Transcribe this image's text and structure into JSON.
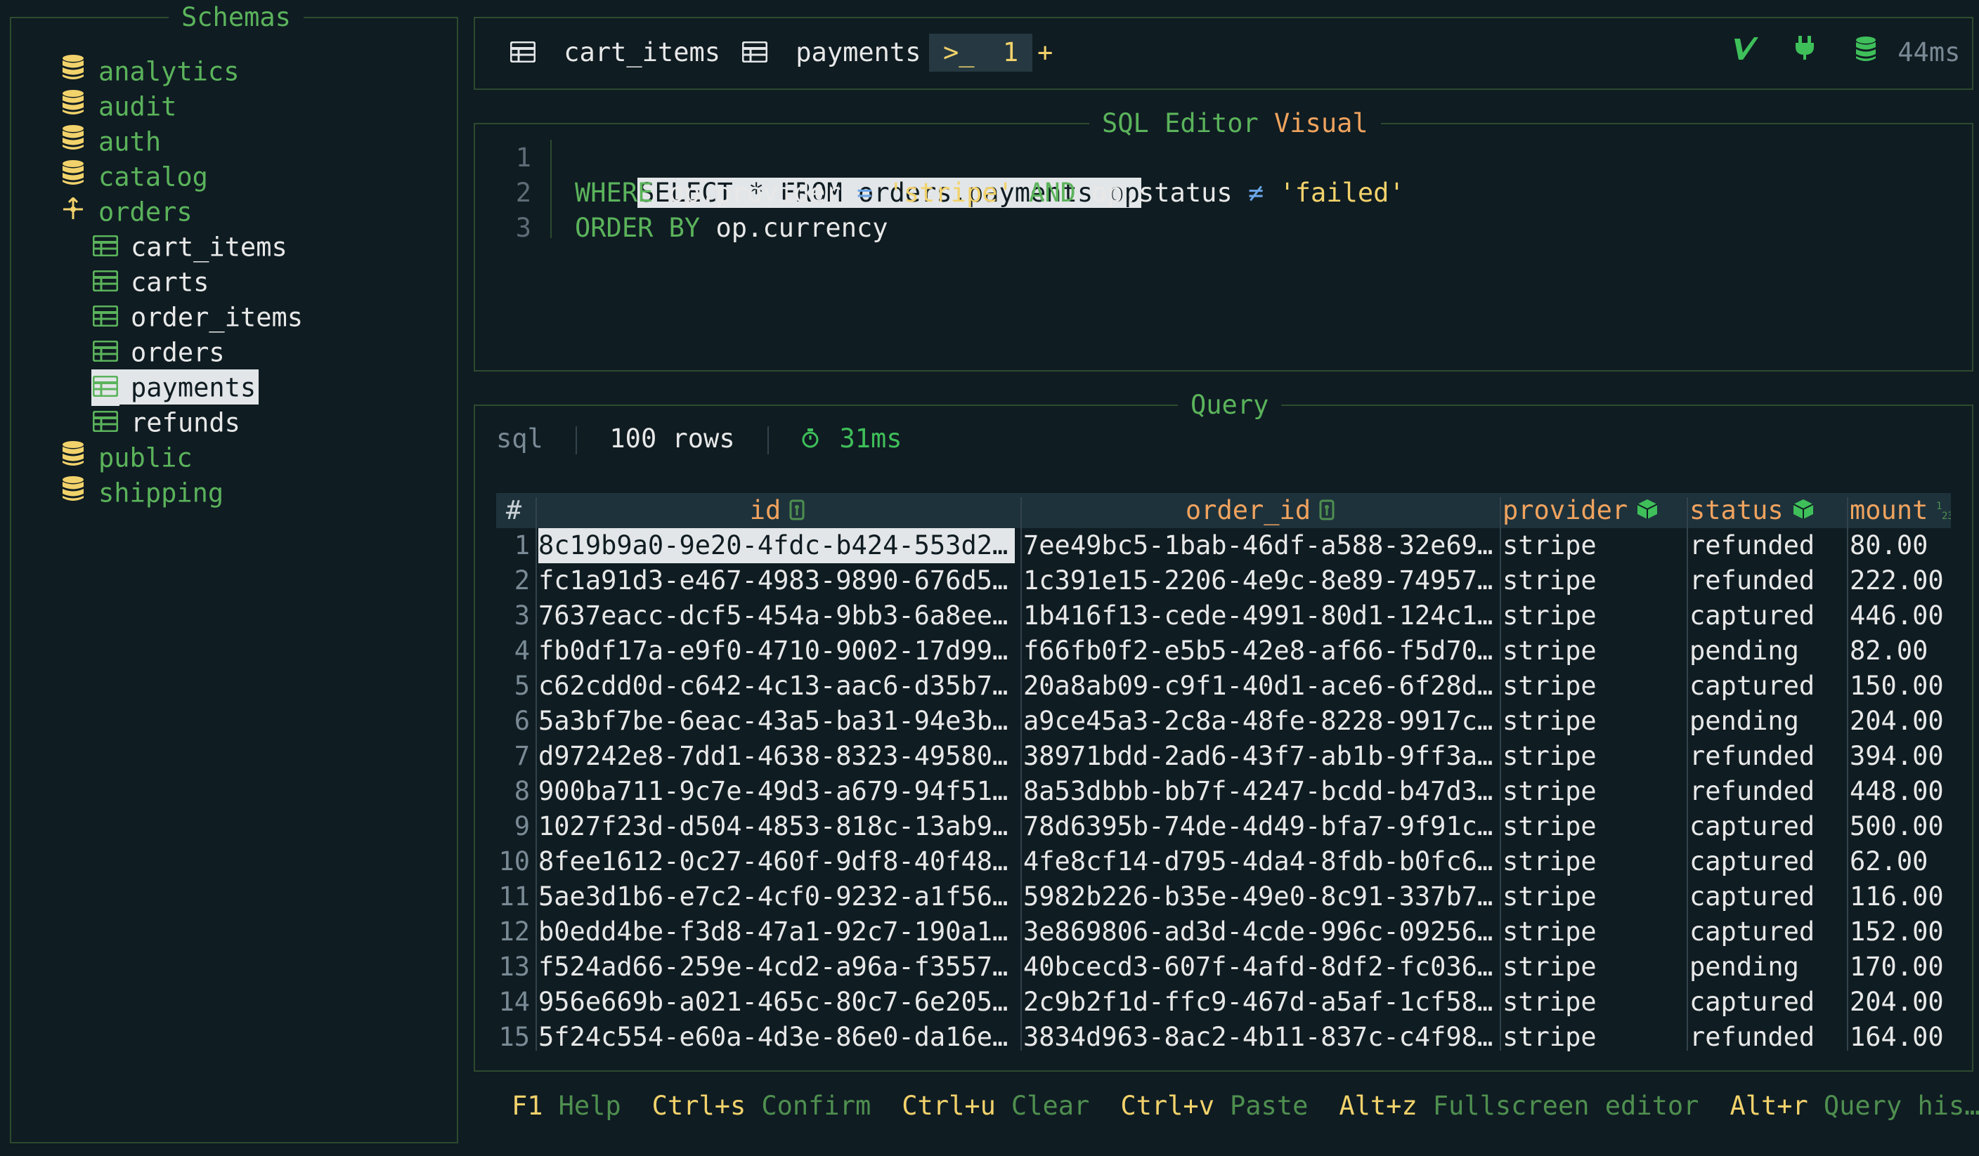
{
  "sidebar": {
    "title": "Schemas",
    "schemas_before": [
      "analytics",
      "audit",
      "auth",
      "catalog"
    ],
    "expanded_schema": "orders",
    "tables": [
      "cart_items",
      "carts",
      "order_items",
      "orders",
      "payments",
      "refunds"
    ],
    "selected_table": "payments",
    "schemas_after": [
      "public",
      "shipping"
    ]
  },
  "tabs": {
    "items": [
      "cart_items",
      "payments"
    ],
    "active": "1",
    "add": "+",
    "latency": "44ms",
    "icons": [
      "table-icon",
      "table-icon",
      "terminal-icon",
      "vim-icon",
      "plug-icon",
      "database-icon"
    ]
  },
  "editor": {
    "title_mode1": "SQL Editor",
    "title_mode2": "Visual",
    "line_numbers": [
      "1",
      "2",
      "3"
    ],
    "line1": "SELECT * FROM orders.payments op",
    "line2": {
      "kw_where": "WHERE",
      "lhs1": "op.provider",
      "eq": "=",
      "val1": "'stripe'",
      "kw_and": "AND",
      "lhs2": "op.status",
      "neq": "≠",
      "val2": "'failed'"
    },
    "line3": {
      "kw_order": "ORDER BY",
      "col": "op.currency"
    }
  },
  "query": {
    "title": "Query",
    "lang": "sql",
    "rows_info": "100 rows",
    "timing": "31ms",
    "columns": [
      "#",
      "id",
      "order_id",
      "provider",
      "status",
      "mount"
    ],
    "rows": [
      [
        "1",
        "8c19b9a0-9e20-4fdc-b424-553d2…",
        "7ee49bc5-1bab-46df-a588-32e69…",
        "stripe",
        "refunded",
        "80.00"
      ],
      [
        "2",
        "fc1a91d3-e467-4983-9890-676d5…",
        "1c391e15-2206-4e9c-8e89-74957…",
        "stripe",
        "refunded",
        "222.00"
      ],
      [
        "3",
        "7637eacc-dcf5-454a-9bb3-6a8ee…",
        "1b416f13-cede-4991-80d1-124c1…",
        "stripe",
        "captured",
        "446.00"
      ],
      [
        "4",
        "fb0df17a-e9f0-4710-9002-17d99…",
        "f66fb0f2-e5b5-42e8-af66-f5d70…",
        "stripe",
        "pending",
        "82.00"
      ],
      [
        "5",
        "c62cdd0d-c642-4c13-aac6-d35b7…",
        "20a8ab09-c9f1-40d1-ace6-6f28d…",
        "stripe",
        "captured",
        "150.00"
      ],
      [
        "6",
        "5a3bf7be-6eac-43a5-ba31-94e3b…",
        "a9ce45a3-2c8a-48fe-8228-9917c…",
        "stripe",
        "pending",
        "204.00"
      ],
      [
        "7",
        "d97242e8-7dd1-4638-8323-49580…",
        "38971bdd-2ad6-43f7-ab1b-9ff3a…",
        "stripe",
        "refunded",
        "394.00"
      ],
      [
        "8",
        "900ba711-9c7e-49d3-a679-94f51…",
        "8a53dbbb-bb7f-4247-bcdd-b47d3…",
        "stripe",
        "refunded",
        "448.00"
      ],
      [
        "9",
        "1027f23d-d504-4853-818c-13ab9…",
        "78d6395b-74de-4d49-bfa7-9f91c…",
        "stripe",
        "captured",
        "500.00"
      ],
      [
        "10",
        "8fee1612-0c27-460f-9df8-40f48…",
        "4fe8cf14-d795-4da4-8fdb-b0fc6…",
        "stripe",
        "captured",
        "62.00"
      ],
      [
        "11",
        "5ae3d1b6-e7c2-4cf0-9232-a1f56…",
        "5982b226-b35e-49e0-8c91-337b7…",
        "stripe",
        "captured",
        "116.00"
      ],
      [
        "12",
        "b0edd4be-f3d8-47a1-92c7-190a1…",
        "3e869806-ad3d-4cde-996c-09256…",
        "stripe",
        "captured",
        "152.00"
      ],
      [
        "13",
        "f524ad66-259e-4cd2-a96a-f3557…",
        "40bcecd3-607f-4afd-8df2-fc036…",
        "stripe",
        "pending",
        "170.00"
      ],
      [
        "14",
        "956e669b-a021-465c-80c7-6e205…",
        "2c9b2f1d-ffc9-467d-a5af-1cf58…",
        "stripe",
        "captured",
        "204.00"
      ],
      [
        "15",
        "5f24c554-e60a-4d3e-86e0-da16e…",
        "3834d963-8ac2-4b11-837c-c4f98…",
        "stripe",
        "refunded",
        "164.00"
      ]
    ]
  },
  "footer": [
    {
      "key": "F1",
      "desc": "Help"
    },
    {
      "key": "Ctrl+s",
      "desc": "Confirm"
    },
    {
      "key": "Ctrl+u",
      "desc": "Clear"
    },
    {
      "key": "Ctrl+v",
      "desc": "Paste"
    },
    {
      "key": "Alt+z",
      "desc": "Fullscreen editor"
    },
    {
      "key": "Alt+r",
      "desc": "Query his…"
    }
  ]
}
